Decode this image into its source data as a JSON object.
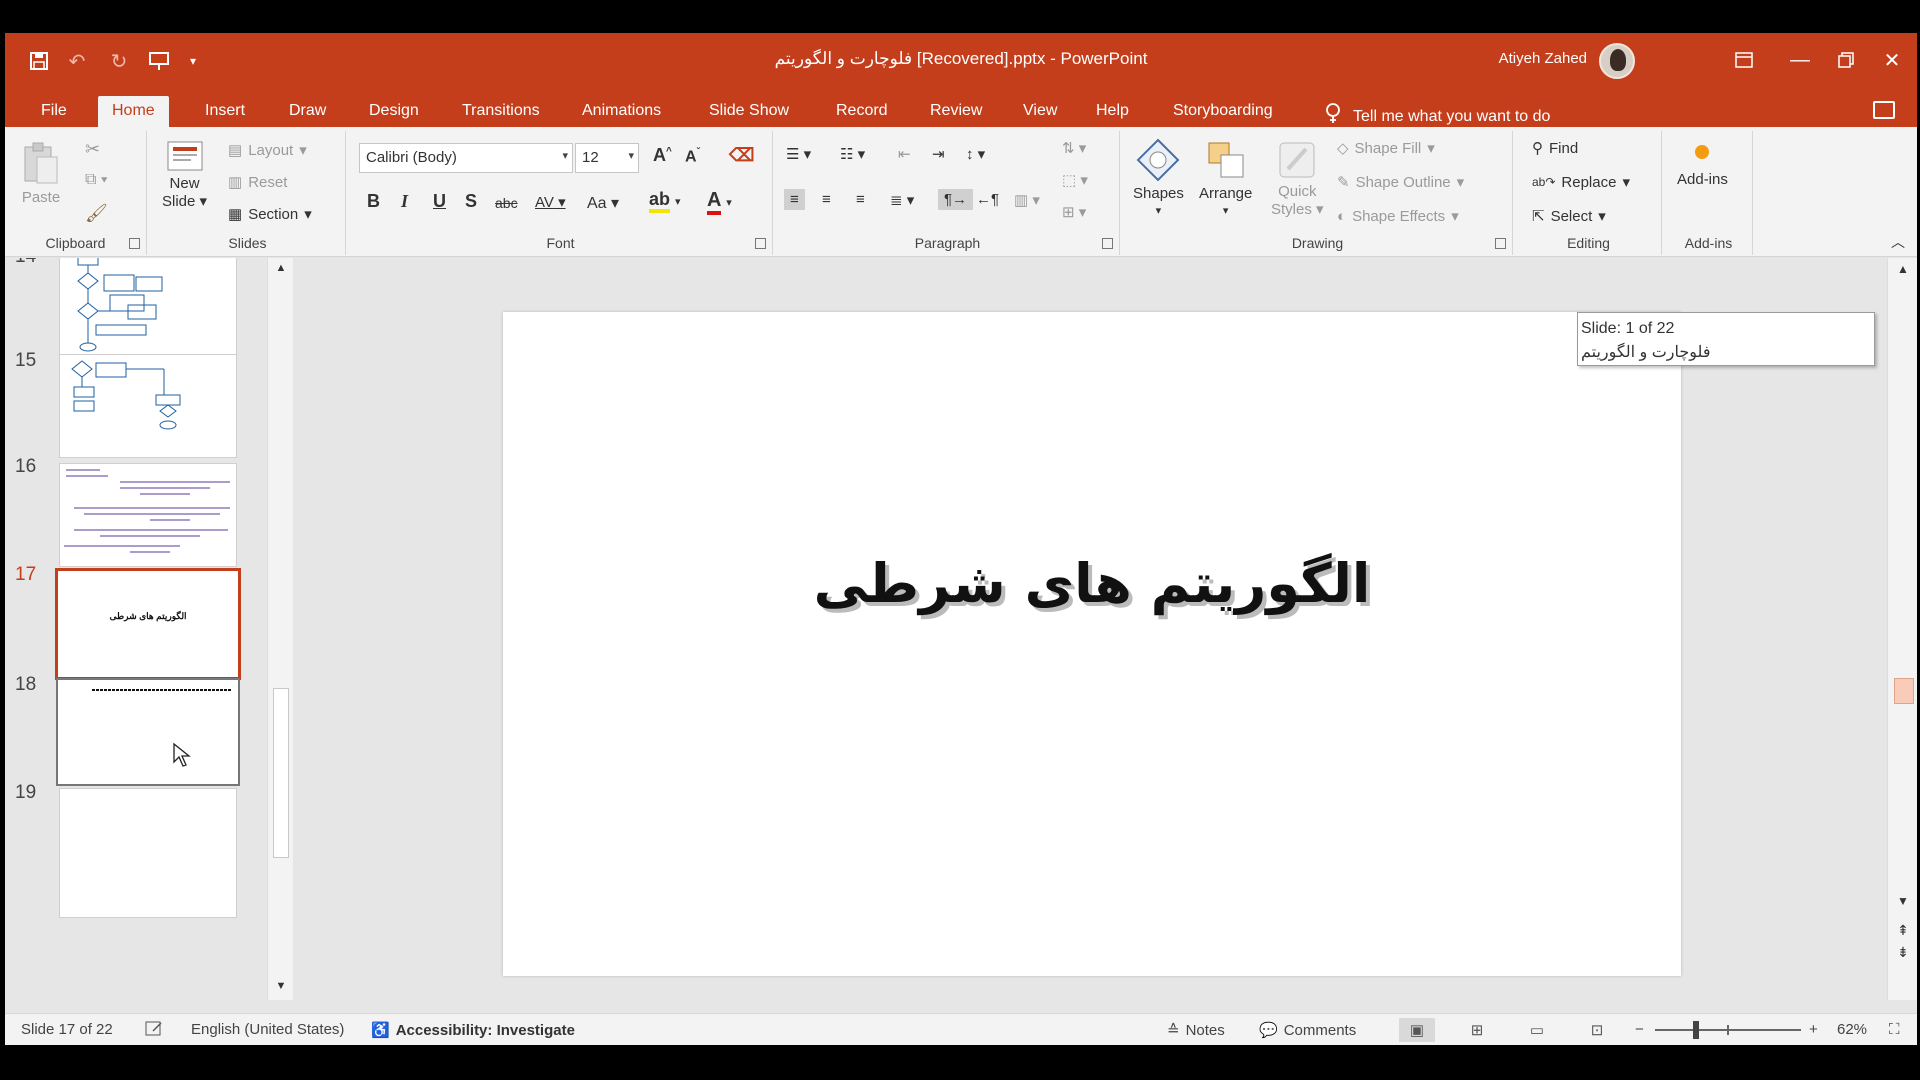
{
  "window": {
    "title": "فلوچارت و الگوریتم [Recovered].pptx  -  PowerPoint",
    "user_name": "Atiyeh Zahed",
    "quick_access": [
      "save-icon",
      "undo-icon",
      "redo-icon",
      "start-from-beginning-icon",
      "customize-qat-icon"
    ]
  },
  "tabs": [
    "File",
    "Home",
    "Insert",
    "Draw",
    "Design",
    "Transitions",
    "Animations",
    "Slide Show",
    "Record",
    "Review",
    "View",
    "Help",
    "Storyboarding"
  ],
  "active_tab": "Home",
  "tell_me": "Tell me what you want to do",
  "ribbon": {
    "clipboard": {
      "paste": "Paste",
      "label": "Clipboard"
    },
    "slides": {
      "new_slide": "New",
      "new_slide2": "Slide",
      "layout": "Layout",
      "reset": "Reset",
      "section": "Section",
      "label": "Slides"
    },
    "font": {
      "name": "Calibri (Body)",
      "size": "12",
      "label": "Font",
      "buttons": [
        "B",
        "I",
        "U",
        "S",
        "abc",
        "AV",
        "Aa"
      ]
    },
    "paragraph": {
      "label": "Paragraph"
    },
    "drawing": {
      "shapes": "Shapes",
      "arrange": "Arrange",
      "quick": "Quick",
      "styles": "Styles",
      "shape_fill": "Shape Fill",
      "shape_outline": "Shape Outline",
      "shape_effects": "Shape Effects",
      "label": "Drawing"
    },
    "editing": {
      "find": "Find",
      "replace": "Replace",
      "select": "Select",
      "label": "Editing"
    },
    "addins": {
      "button": "Add-ins",
      "label": "Add-ins"
    }
  },
  "thumbnails": [
    {
      "number": "14",
      "state": "normal"
    },
    {
      "number": "15",
      "state": "normal"
    },
    {
      "number": "16",
      "state": "normal"
    },
    {
      "number": "17",
      "state": "active",
      "mini_title": "الگوریتم های شرطی"
    },
    {
      "number": "18",
      "state": "hover"
    },
    {
      "number": "19",
      "state": "normal"
    }
  ],
  "slide": {
    "title": "الگوریتم های شرطی"
  },
  "scroll_tooltip": {
    "line1": "Slide: 1 of 22",
    "line2": "فلوچارت و الگوریتم"
  },
  "status": {
    "slide_count": "Slide 17 of 22",
    "language": "English (United States)",
    "accessibility": "Accessibility: Investigate",
    "notes": "Notes",
    "comments": "Comments",
    "zoom": "62%"
  },
  "colors": {
    "accent": "#c43e1c",
    "ribbon_bg": "#f3f3f3",
    "workspace_bg": "#e6e6e6"
  }
}
